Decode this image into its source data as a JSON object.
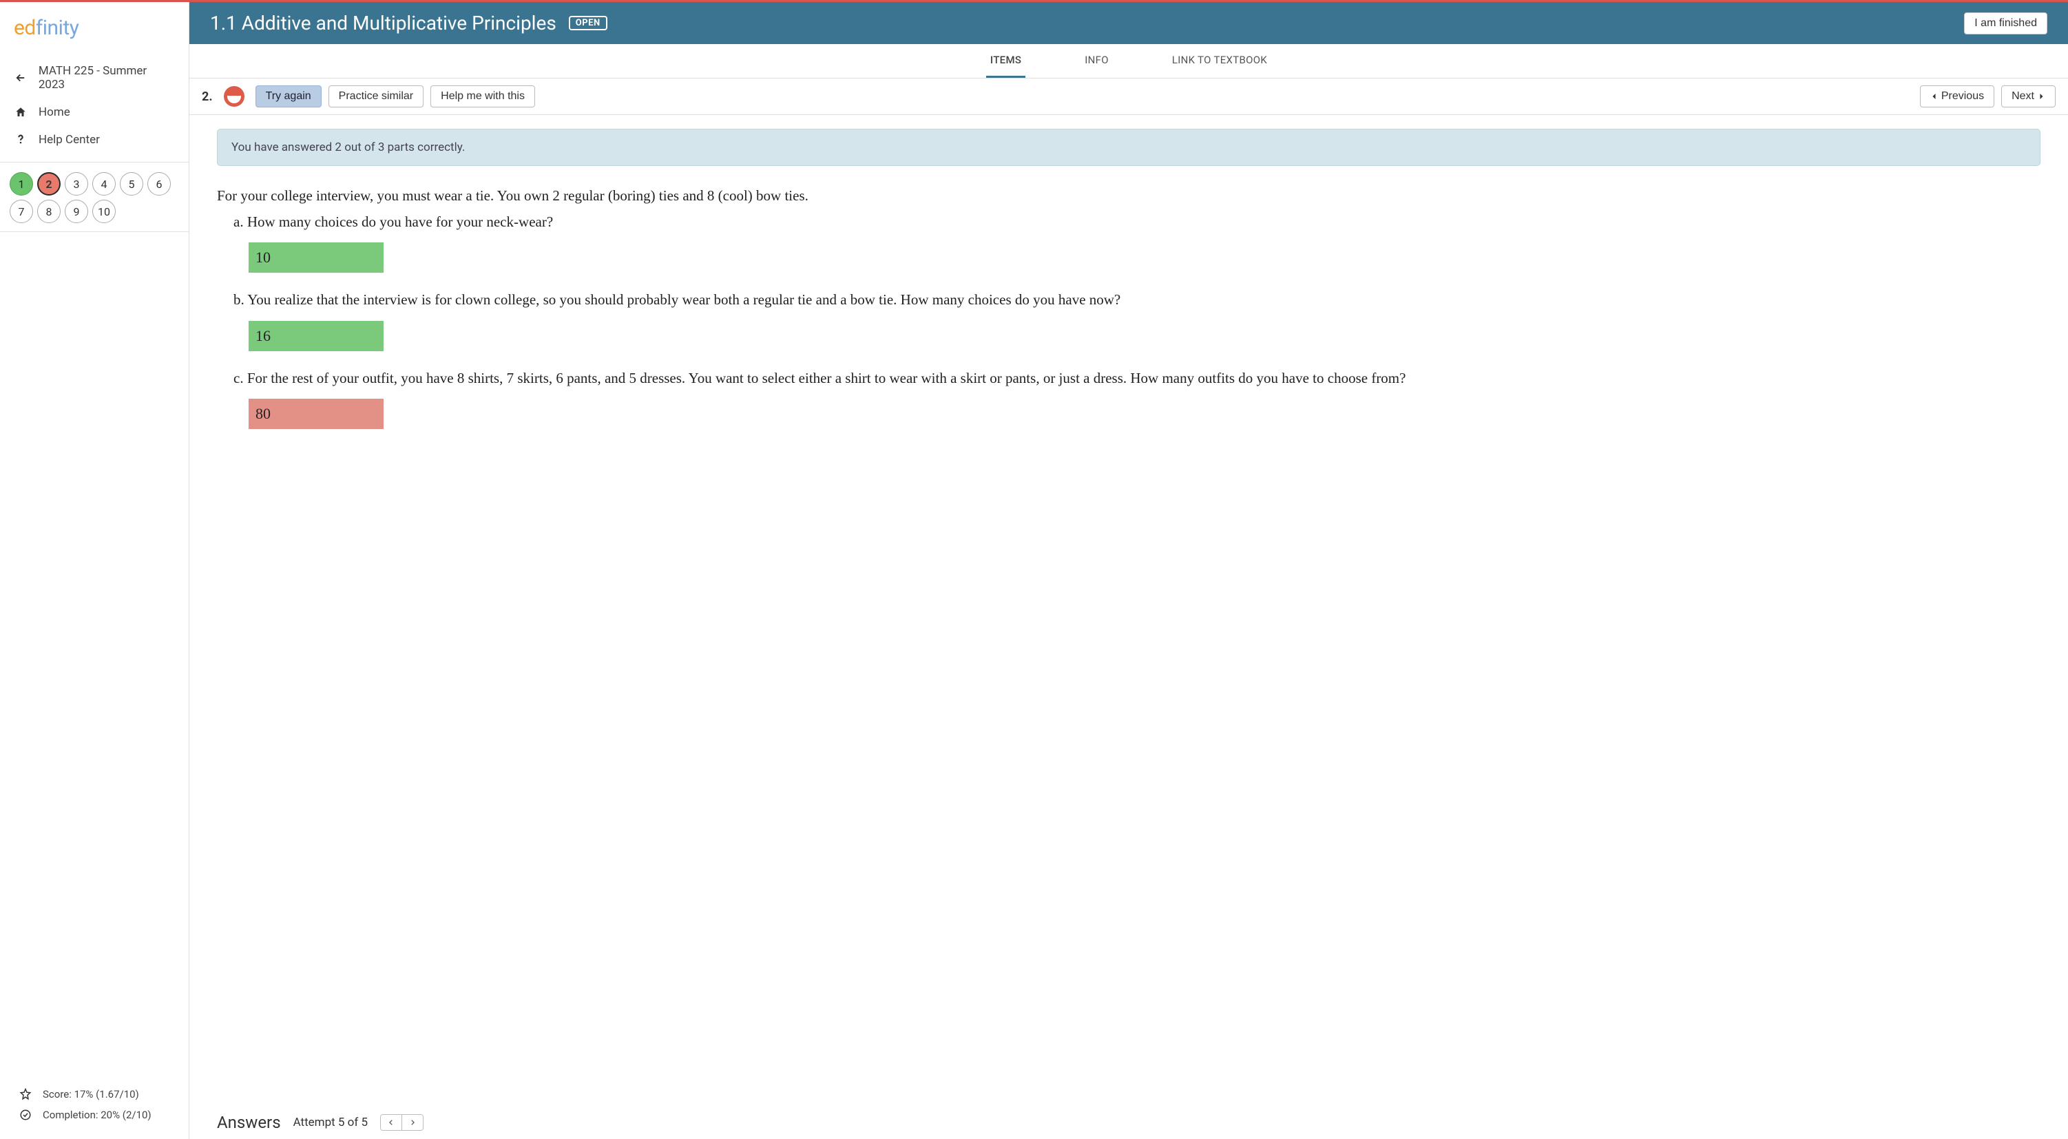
{
  "brand": {
    "part1": "ed",
    "part2": "finity"
  },
  "sidebar": {
    "course": "MATH 225 - Summer 2023",
    "home": "Home",
    "help_center": "Help Center"
  },
  "questions": [
    {
      "n": "1",
      "state": "correct"
    },
    {
      "n": "2",
      "state": "current-wrong"
    },
    {
      "n": "3",
      "state": ""
    },
    {
      "n": "4",
      "state": ""
    },
    {
      "n": "5",
      "state": ""
    },
    {
      "n": "6",
      "state": ""
    },
    {
      "n": "7",
      "state": ""
    },
    {
      "n": "8",
      "state": ""
    },
    {
      "n": "9",
      "state": ""
    },
    {
      "n": "10",
      "state": ""
    }
  ],
  "footer": {
    "score": "Score: 17% (1.67/10)",
    "completion": "Completion: 20% (2/10)"
  },
  "header": {
    "title": "1.1 Additive and Multiplicative Principles",
    "open_badge": "OPEN",
    "finished": "I am finished"
  },
  "tabs": {
    "items": "ITEMS",
    "info": "INFO",
    "link": "LINK TO TEXTBOOK"
  },
  "toolbar": {
    "qnum": "2.",
    "try_again": "Try again",
    "practice": "Practice similar",
    "help": "Help me with this",
    "prev": "Previous",
    "next": "Next"
  },
  "alert": "You have answered 2 out of 3 parts correctly.",
  "question": {
    "intro": "For your college interview, you must wear a tie. You own 2 regular (boring) ties and 8 (cool) bow ties.",
    "parts": [
      {
        "label": "a.",
        "text": "How many choices do you have for your neck-wear?",
        "value": "10",
        "state": "correct"
      },
      {
        "label": "b.",
        "text": "You realize that the interview is for clown college, so you should probably wear both a regular tie and a bow tie. How many choices do you have now?",
        "value": "16",
        "state": "correct"
      },
      {
        "label": "c.",
        "text": "For the rest of your outfit, you have 8 shirts, 7 skirts, 6 pants, and 5 dresses. You want to select either a shirt to wear with a skirt or pants, or just a dress. How many outfits do you have to choose from?",
        "value": "80",
        "state": "incorrect"
      }
    ]
  },
  "answers_bar": {
    "title": "Answers",
    "attempt": "Attempt 5 of 5"
  }
}
